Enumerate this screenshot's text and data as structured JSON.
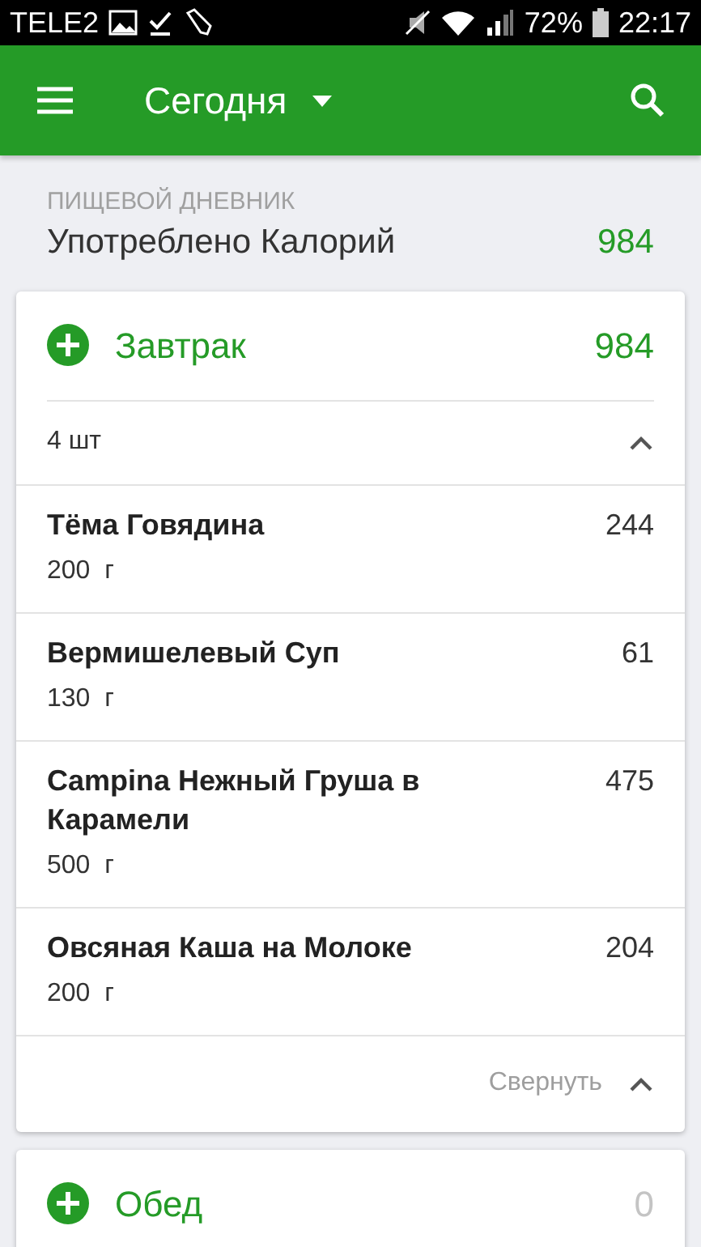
{
  "status_bar": {
    "carrier": "TELE2",
    "battery": "72%",
    "time": "22:17"
  },
  "app_bar": {
    "title": "Сегодня"
  },
  "summary": {
    "label": "ПИЩЕВОЙ ДНЕВНИК",
    "title": "Употреблено Калорий",
    "value": "984"
  },
  "meals": [
    {
      "name": "Завтрак",
      "calories": "984",
      "empty": false,
      "count": "4 шт",
      "expanded": true,
      "items": [
        {
          "name": "Тёма Говядина",
          "amount": "200  г",
          "calories": "244"
        },
        {
          "name": "Вермишелевый Суп",
          "amount": "130  г",
          "calories": "61"
        },
        {
          "name": "Campina Нежный Груша в Карамели",
          "amount": "500  г",
          "calories": "475"
        },
        {
          "name": "Овсяная Каша на Молоке",
          "amount": "200  г",
          "calories": "204"
        }
      ],
      "collapse_label": "Свернуть"
    },
    {
      "name": "Обед",
      "calories": "0",
      "empty": true
    }
  ]
}
